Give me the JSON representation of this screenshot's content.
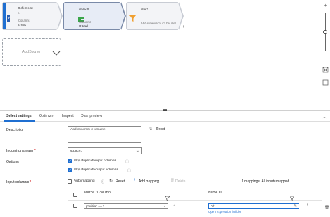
{
  "pipeline": {
    "source_node": {
      "title": "Reference",
      "subtitle": "1",
      "columns_label": "Columns",
      "columns_value": "0 total"
    },
    "select_node": {
      "title": "select1",
      "columns_label": "Columns",
      "columns_value": "0 total"
    },
    "filter_node": {
      "title": "filter1",
      "hint": "Add expression for the filter"
    },
    "add_source_label": "Add Source"
  },
  "tabs": [
    "Select settings",
    "Optimize",
    "Inspect",
    "Data preview"
  ],
  "form": {
    "description_label": "Description",
    "description_value": "Add columns to rename",
    "reset_label": "Reset",
    "incoming_stream_label": "Incoming stream",
    "incoming_stream_value": "source1",
    "options_label": "Options",
    "skip_input_label": "Skip duplicate input columns",
    "skip_output_label": "Skip duplicate output columns",
    "input_columns_label": "Input columns",
    "auto_mapping_label": "Auto mapping",
    "mapping_reset_label": "Reset",
    "add_mapping_label": "Add mapping",
    "delete_label": "Delete",
    "mappings_status": "1 mappings: All inputs mapped"
  },
  "mapping": {
    "source_header": "source1's column",
    "name_header": "Name as",
    "source_value": "position == 1",
    "operator": "→",
    "name_value": "'id'",
    "expression_link": "Open expression builder"
  },
  "colors": {
    "accent": "#1f6fd1",
    "filter_icon": "#f0a030",
    "select_icon": "#3aa54a"
  }
}
